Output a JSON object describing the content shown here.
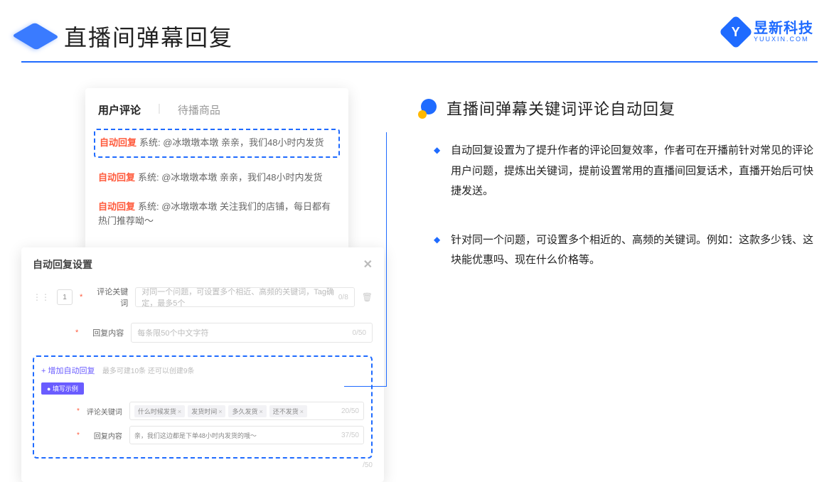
{
  "header": {
    "title": "直播间弹幕回复"
  },
  "brand": {
    "cn": "昱新科技",
    "en": "YUUXIN.COM",
    "mark": "Y"
  },
  "comments": {
    "tabs": {
      "active": "用户评论",
      "inactive": "待播商品"
    },
    "items": [
      {
        "tag": "自动回复",
        "text": "系统: @冰墩墩本墩 亲亲，我们48小时内发货"
      },
      {
        "tag": "自动回复",
        "text": "系统: @冰墩墩本墩 亲亲，我们48小时内发货"
      },
      {
        "tag": "自动回复",
        "text": "系统: @冰墩墩本墩 关注我们的店铺，每日都有热门推荐呦～"
      }
    ]
  },
  "settings": {
    "title": "自动回复设置",
    "idx": "1",
    "label_kw": "评论关键词",
    "ph_kw": "对同一个问题，可设置多个相近、高频的关键词，Tag确定，最多5个",
    "cnt_kw": "0/8",
    "label_content": "回复内容",
    "ph_content": "每条限50个中文字符",
    "cnt_content": "0/50",
    "add_link": "+ 增加自动回复",
    "add_hint": "最多可建10条 还可以创建9条",
    "ex_badge": "● 填写示例",
    "ex_label_kw": "评论关键词",
    "ex_tags": [
      "什么时候发货",
      "发货时间",
      "多久发货",
      "还不发货"
    ],
    "ex_cnt_kw": "20/50",
    "ex_label_c": "回复内容",
    "ex_value_c": "亲，我们这边都是下单48小时内发货的哦～",
    "ex_cnt_c": "37/50",
    "outer_cnt": "/50"
  },
  "section": {
    "title": "直播间弹幕关键词评论自动回复",
    "bullets": [
      "自动回复设置为了提升作者的评论回复效率，作者可在开播前针对常见的评论用户问题，提炼出关键词，提前设置常用的直播间回复话术，直播开始后可快捷发送。",
      "针对同一个问题，可设置多个相近的、高频的关键词。例如：这款多少钱、这块能优惠吗、现在什么价格等。"
    ]
  }
}
